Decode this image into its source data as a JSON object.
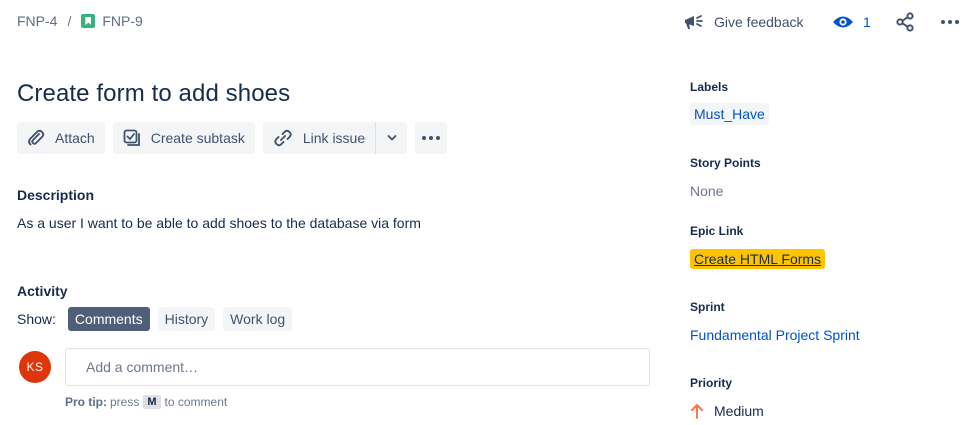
{
  "breadcrumb": {
    "parent": "FNP-4",
    "separator": "/",
    "current": "FNP-9"
  },
  "top_actions": {
    "feedback_label": "Give feedback",
    "watch_count": "1"
  },
  "issue": {
    "title": "Create form to add shoes"
  },
  "toolbar": {
    "attach": "Attach",
    "create_subtask": "Create subtask",
    "link_issue": "Link issue"
  },
  "description": {
    "heading": "Description",
    "text": "As a user I want to be able to add shoes to the database via form"
  },
  "activity": {
    "heading": "Activity",
    "show_label": "Show:",
    "tabs": [
      "Comments",
      "History",
      "Work log"
    ],
    "active_tab": "Comments",
    "avatar_initials": "KS",
    "comment_placeholder": "Add a comment…",
    "protip_bold": "Pro tip:",
    "protip_before": "press",
    "protip_key": "M",
    "protip_after": "to comment"
  },
  "sidebar": {
    "labels": {
      "label": "Labels",
      "value": "Must_Have"
    },
    "story_points": {
      "label": "Story Points",
      "value": "None"
    },
    "epic_link": {
      "label": "Epic Link",
      "value": "Create HTML Forms"
    },
    "sprint": {
      "label": "Sprint",
      "value": "Fundamental Project Sprint"
    },
    "priority": {
      "label": "Priority",
      "value": "Medium"
    }
  },
  "colors": {
    "story_icon": "#36b37e",
    "link_blue": "#0052cc",
    "epic_yellow": "#ffc400",
    "avatar_red": "#de350b",
    "priority_orange": "#ff7452",
    "active_chip": "#505f79"
  },
  "icons": [
    "story-icon",
    "megaphone-icon",
    "eye-icon",
    "share-icon",
    "more-icon",
    "paperclip-icon",
    "subtask-icon",
    "link-icon",
    "chevron-down-icon",
    "arrow-up-icon"
  ]
}
